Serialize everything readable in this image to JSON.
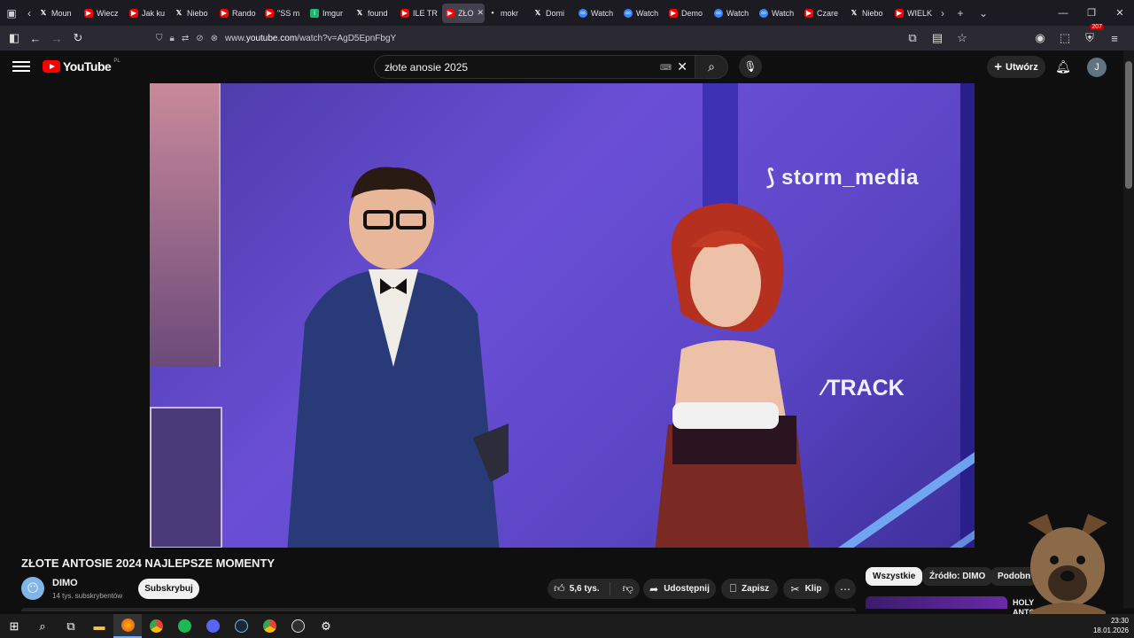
{
  "browser": {
    "tabs": [
      {
        "label": "Moun",
        "icon": "x"
      },
      {
        "label": "Wiecz",
        "icon": "youtube"
      },
      {
        "label": "Jak ku",
        "icon": "youtube"
      },
      {
        "label": "Niebo",
        "icon": "x"
      },
      {
        "label": "Rando",
        "icon": "youtube"
      },
      {
        "label": "\"SS m",
        "icon": "youtube"
      },
      {
        "label": "Imgur",
        "icon": "imgur"
      },
      {
        "label": "found",
        "icon": "x"
      },
      {
        "label": "ILE TR",
        "icon": "youtube"
      },
      {
        "label": "ZŁO",
        "icon": "youtube",
        "active": true
      },
      {
        "label": "mokr",
        "icon": "dot"
      },
      {
        "label": "Domi",
        "icon": "x"
      },
      {
        "label": "Watch",
        "icon": "watch"
      },
      {
        "label": "Watch",
        "icon": "watch"
      },
      {
        "label": "Demo",
        "icon": "youtube"
      },
      {
        "label": "Watch",
        "icon": "watch"
      },
      {
        "label": "Watch",
        "icon": "watch"
      },
      {
        "label": "Czare",
        "icon": "youtube"
      },
      {
        "label": "Niebo",
        "icon": "x"
      },
      {
        "label": "WIELK",
        "icon": "youtube"
      }
    ],
    "url_prefix": "www.",
    "url_host": "youtube.com",
    "url_path": "/watch?v=AgD5EpnFbgY",
    "extension_badge": "207"
  },
  "youtube": {
    "logo_text": "YouTube",
    "country_code": "PL",
    "search_value": "złote anosie 2025",
    "create_label": "Utwórz",
    "avatar_letter": "J"
  },
  "video": {
    "brand_1": "storm_media",
    "brand_2": "TRACK",
    "title": "ZŁOTE ANTOSIE 2024 NAJLEPSZE MOMENTY",
    "channel_name": "DIMO",
    "channel_subs": "14 tys. subskrybentów",
    "subscribe_label": "Subskrybuj",
    "likes": "5,6 tys.",
    "share_label": "Udostępnij",
    "save_label": "Zapisz",
    "clip_label": "Klip"
  },
  "sidebar": {
    "chips": [
      "Wszystkie",
      "Źródło: DIMO",
      "Podobn"
    ],
    "rec_title_line1": "HOLY",
    "rec_title_line2": "ANTO"
  },
  "taskbar": {
    "time": "23:30",
    "date": "18.01.2026"
  }
}
